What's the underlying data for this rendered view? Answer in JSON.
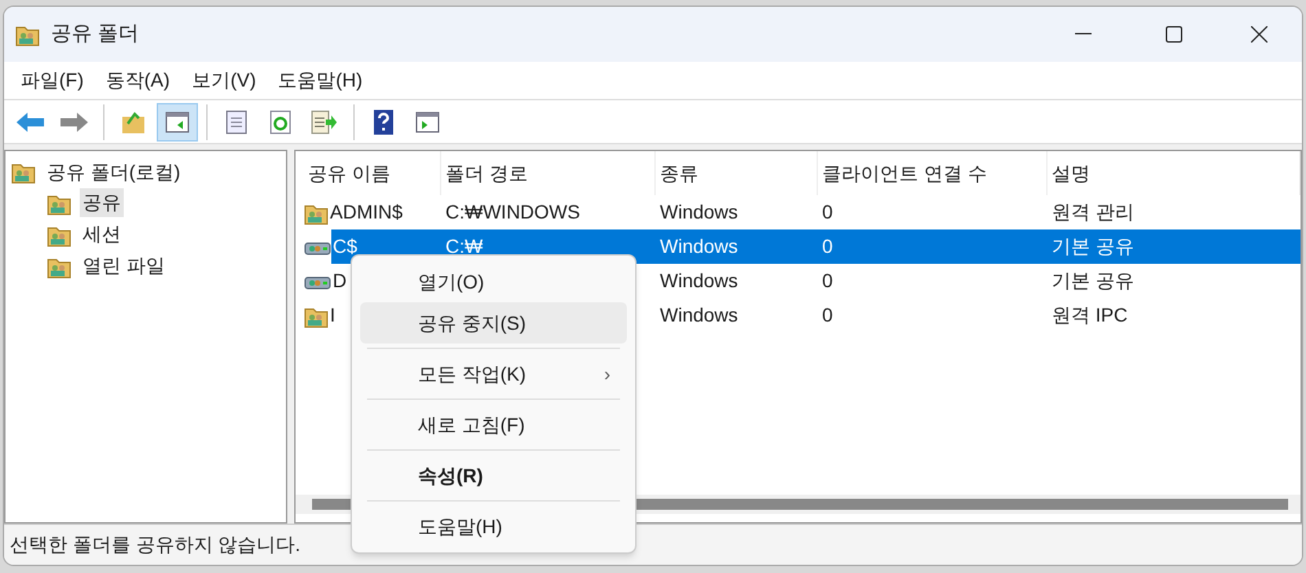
{
  "window": {
    "title": "공유 폴더"
  },
  "menu_bar": [
    "파일(F)",
    "동작(A)",
    "보기(V)",
    "도움말(H)"
  ],
  "toolbar": [
    [
      {
        "kind": "back",
        "selected": false
      },
      {
        "kind": "forward",
        "selected": false
      }
    ],
    [
      {
        "kind": "up",
        "selected": false
      },
      {
        "kind": "pane",
        "selected": true
      }
    ],
    [
      {
        "kind": "props",
        "selected": false
      },
      {
        "kind": "refresh",
        "selected": false
      },
      {
        "kind": "export",
        "selected": false
      }
    ],
    [
      {
        "kind": "help",
        "selected": false
      },
      {
        "kind": "action",
        "selected": false
      }
    ]
  ],
  "tree": {
    "label": "공유 폴더(로컬)",
    "children": [
      {
        "label": "공유",
        "selected": true
      },
      {
        "label": "세션",
        "selected": false
      },
      {
        "label": "열린 파일",
        "selected": false
      }
    ]
  },
  "table": {
    "columns": [
      "공유 이름",
      "폴더 경로",
      "종류",
      "클라이언트 연결 수",
      "설명"
    ],
    "rows": [
      {
        "kind": "folder",
        "cells": [
          "ADMIN$",
          "C:₩WINDOWS",
          "Windows",
          "0",
          "원격 관리"
        ],
        "selected": false
      },
      {
        "kind": "drive",
        "cells": [
          "C$",
          "C:₩",
          "Windows",
          "0",
          "기본 공유"
        ],
        "selected": true
      },
      {
        "kind": "drive",
        "cells": [
          "D",
          "",
          "Windows",
          "0",
          "기본 공유"
        ],
        "selected": false
      },
      {
        "kind": "folder",
        "cells": [
          "I",
          "",
          "Windows",
          "0",
          "원격 IPC"
        ],
        "selected": false
      }
    ]
  },
  "context_menu": [
    {
      "kind": "item",
      "label": "열기(O)",
      "selected": false,
      "bold": false
    },
    {
      "kind": "item",
      "label": "공유 중지(S)",
      "selected": true,
      "bold": false
    },
    {
      "kind": "separator"
    },
    {
      "kind": "item",
      "label": "모든 작업(K)",
      "selected": false,
      "bold": false,
      "submenu": "›"
    },
    {
      "kind": "separator"
    },
    {
      "kind": "item",
      "label": "새로 고침(F)",
      "selected": false,
      "bold": false
    },
    {
      "kind": "separator"
    },
    {
      "kind": "item",
      "label": "속성(R)",
      "selected": false,
      "bold": true
    },
    {
      "kind": "separator"
    },
    {
      "kind": "item",
      "label": "도움말(H)",
      "selected": false,
      "bold": false
    }
  ],
  "status_bar": "선택한 폴더를 공유하지 않습니다."
}
